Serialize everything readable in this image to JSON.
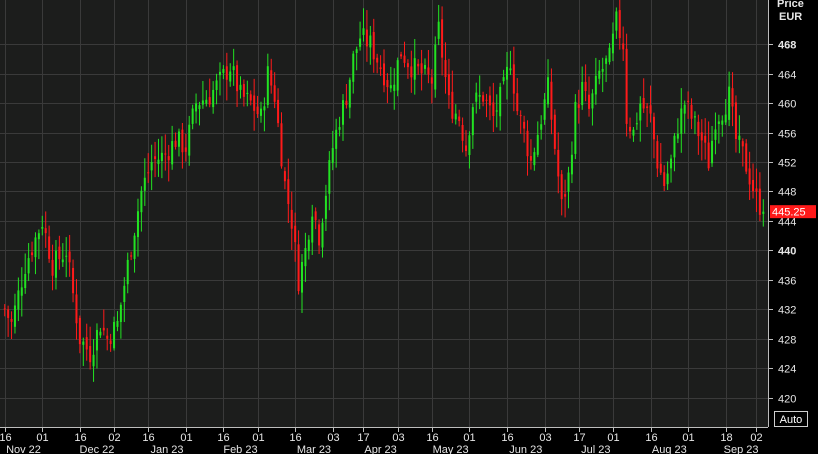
{
  "chart_data": {
    "type": "candlestick",
    "ylabel": [
      "Price",
      "EUR"
    ],
    "ylim": [
      416,
      474
    ],
    "y_ticks": [
      420,
      424,
      428,
      432,
      436,
      440,
      444,
      448,
      452,
      456,
      460,
      464,
      468
    ],
    "y_ticks_bold": [
      440,
      468
    ],
    "grid": true,
    "last_price": "445.25",
    "colors": {
      "up": "#22e322",
      "down": "#ff1a1a",
      "background": "#1c1d1c",
      "grid": "#3a3a3a",
      "last_price_bg": "#ff1a1a"
    },
    "x_ticks": [
      {
        "i": 0,
        "day": "16",
        "month": "Nov 22"
      },
      {
        "i": 11,
        "day": "01",
        "month": ""
      },
      {
        "i": 22,
        "day": "16",
        "month": "Dec 22"
      },
      {
        "i": 32,
        "day": "02",
        "month": ""
      },
      {
        "i": 42,
        "day": "16",
        "month": "Jan 23"
      },
      {
        "i": 53,
        "day": "01",
        "month": ""
      },
      {
        "i": 64,
        "day": "16",
        "month": "Feb 23"
      },
      {
        "i": 74,
        "day": "01",
        "month": ""
      },
      {
        "i": 85,
        "day": "16",
        "month": "Mar 23"
      },
      {
        "i": 96,
        "day": "03",
        "month": ""
      },
      {
        "i": 105,
        "day": "17",
        "month": "Apr 23"
      },
      {
        "i": 115,
        "day": "03",
        "month": ""
      },
      {
        "i": 125,
        "day": "16",
        "month": "May 23"
      },
      {
        "i": 136,
        "day": "01",
        "month": ""
      },
      {
        "i": 147,
        "day": "16",
        "month": "Jun 23"
      },
      {
        "i": 158,
        "day": "03",
        "month": ""
      },
      {
        "i": 168,
        "day": "17",
        "month": "Jul 23"
      },
      {
        "i": 178,
        "day": "01",
        "month": ""
      },
      {
        "i": 189,
        "day": "16",
        "month": "Aug 23"
      },
      {
        "i": 200,
        "day": "01",
        "month": ""
      },
      {
        "i": 211,
        "day": "18",
        "month": "Sep 23"
      },
      {
        "i": 220,
        "day": "02",
        "month": ""
      }
    ],
    "close_path": [
      [
        0,
        432
      ],
      [
        2,
        430
      ],
      [
        6,
        438
      ],
      [
        11,
        444
      ],
      [
        14,
        438
      ],
      [
        18,
        440
      ],
      [
        22,
        428
      ],
      [
        25,
        426
      ],
      [
        28,
        430
      ],
      [
        30,
        428
      ],
      [
        33,
        430
      ],
      [
        36,
        438
      ],
      [
        40,
        448
      ],
      [
        43,
        452
      ],
      [
        47,
        453
      ],
      [
        50,
        455
      ],
      [
        53,
        454
      ],
      [
        56,
        460
      ],
      [
        60,
        461
      ],
      [
        63,
        463
      ],
      [
        66,
        465
      ],
      [
        69,
        461
      ],
      [
        72,
        460
      ],
      [
        75,
        458
      ],
      [
        77,
        464
      ],
      [
        79,
        461
      ],
      [
        82,
        449
      ],
      [
        84,
        444
      ],
      [
        86,
        436
      ],
      [
        88,
        440
      ],
      [
        90,
        446
      ],
      [
        92,
        442
      ],
      [
        94,
        448
      ],
      [
        96,
        454
      ],
      [
        98,
        458
      ],
      [
        100,
        461
      ],
      [
        102,
        466
      ],
      [
        104,
        469
      ],
      [
        107,
        468
      ],
      [
        110,
        465
      ],
      [
        113,
        462
      ],
      [
        116,
        467
      ],
      [
        119,
        465
      ],
      [
        122,
        464
      ],
      [
        125,
        463
      ],
      [
        127,
        470
      ],
      [
        130,
        460
      ],
      [
        133,
        458
      ],
      [
        135,
        454
      ],
      [
        137,
        460
      ],
      [
        140,
        461
      ],
      [
        143,
        458
      ],
      [
        146,
        462
      ],
      [
        148,
        466
      ],
      [
        150,
        459
      ],
      [
        152,
        456
      ],
      [
        154,
        452
      ],
      [
        157,
        458
      ],
      [
        159,
        462
      ],
      [
        161,
        454
      ],
      [
        163,
        446
      ],
      [
        165,
        450
      ],
      [
        167,
        459
      ],
      [
        169,
        462
      ],
      [
        171,
        459
      ],
      [
        174,
        464
      ],
      [
        177,
        466
      ],
      [
        179,
        471
      ],
      [
        181,
        468
      ],
      [
        182,
        458
      ],
      [
        184,
        456
      ],
      [
        186,
        460
      ],
      [
        189,
        458
      ],
      [
        191,
        452
      ],
      [
        193,
        449
      ],
      [
        195,
        452
      ],
      [
        197,
        457
      ],
      [
        199,
        460
      ],
      [
        201,
        458
      ],
      [
        204,
        455
      ],
      [
        206,
        452
      ],
      [
        208,
        458
      ],
      [
        210,
        459
      ],
      [
        212,
        461
      ],
      [
        214,
        455
      ],
      [
        216,
        453
      ],
      [
        218,
        450
      ],
      [
        220,
        447
      ],
      [
        222,
        445.25
      ]
    ],
    "seed": 7,
    "n_candles": 223
  },
  "ui": {
    "auto_label": "Auto"
  }
}
